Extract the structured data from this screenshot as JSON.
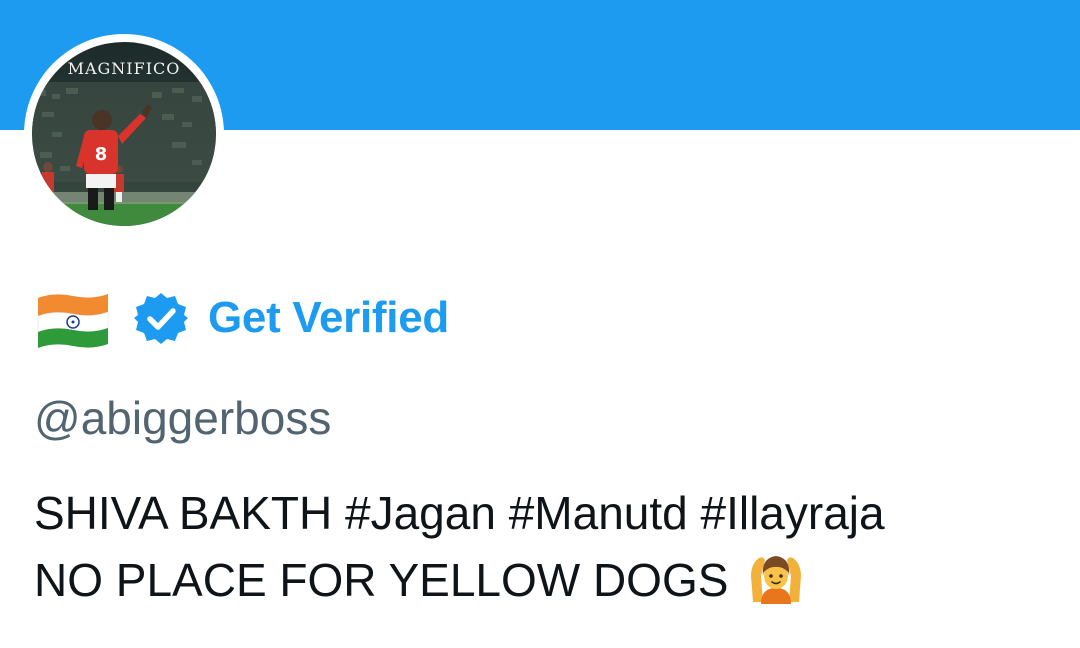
{
  "banner": {
    "color": "#1d9bf0"
  },
  "avatar": {
    "caption": "MAGNIFICO",
    "jersey_number": "8",
    "icon": "profile-photo"
  },
  "profile": {
    "flag_icon": "india-flag-icon",
    "verified_badge_icon": "verified-badge-icon",
    "get_verified_label": "Get Verified",
    "handle": "@abiggerboss",
    "bio_line1": "SHIVA BAKTH #Jagan #Manutd #Illayraja",
    "bio_line2": "NO PLACE FOR YELLOW DOGS",
    "bio_emoji_icon": "person-gesturing-ok-icon"
  },
  "colors": {
    "accent": "#1d9bf0",
    "text_primary": "#0f1419",
    "text_secondary": "#536471"
  }
}
